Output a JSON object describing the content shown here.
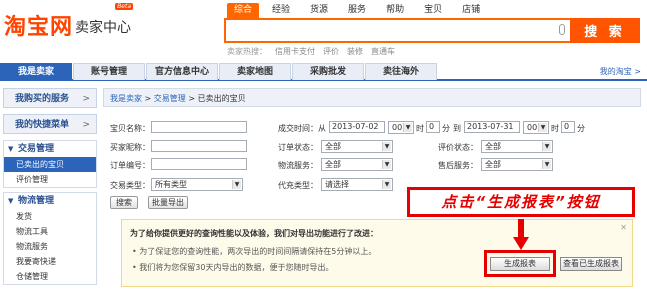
{
  "logo": {
    "main": "淘宝网",
    "sub": "卖家中心",
    "beta": "Beta"
  },
  "top_tabs": [
    "综合",
    "经验",
    "货源",
    "服务",
    "帮助",
    "宝贝",
    "店铺"
  ],
  "search": {
    "button": "搜 索",
    "value": ""
  },
  "hot": {
    "label": "卖家热搜：",
    "items": [
      "信用卡支付",
      "评价",
      "装修",
      "直通车"
    ]
  },
  "nav": {
    "items": [
      "我是卖家",
      "账号管理",
      "官方信息中心",
      "卖家地图",
      "采购批发",
      "卖往海外"
    ],
    "right": "我的淘宝 >"
  },
  "sidebar": {
    "boxes": [
      "我购买的服务",
      "我的快捷菜单"
    ],
    "arrow": ">",
    "section1": {
      "head": "交易管理",
      "links": [
        "已卖出的宝贝",
        "评价管理"
      ]
    },
    "section2": {
      "head": "物流管理",
      "links": [
        "发货",
        "物流工具",
        "物流服务",
        "我要寄快递",
        "仓储管理"
      ]
    }
  },
  "breadcrumb": {
    "a": "我是卖家",
    "sep": " > ",
    "b": "交易管理",
    "c": "已卖出的宝贝"
  },
  "form": {
    "item_name": "宝贝名称：",
    "buyer_nick": "买家昵称：",
    "order_no": "订单编号：",
    "trade_type": "交易类型：",
    "trade_type_value": "所有类型",
    "deal_time": "成交时间：从",
    "date_from": "2013-07-02",
    "hour_from": "00",
    "min_from": "0",
    "to": "到",
    "date_to": "2013-07-31",
    "hour_to": "00",
    "min_to": "0",
    "hour_unit": "时",
    "min_unit": "分",
    "order_status": "订单状态：",
    "order_status_value": "全部",
    "logistics": "物流服务：",
    "logistics_value": "全部",
    "collect_type": "代充类型：",
    "collect_type_value": "请选择",
    "rate_status": "评价状态：",
    "rate_status_value": "全部",
    "after_sale": "售后服务：",
    "after_sale_value": "全部",
    "search_btn": "搜索",
    "export_btn": "批量导出"
  },
  "notice": {
    "title": "为了给你提供更好的查询性能以及体验，我们对导出功能进行了改进：",
    "line1": "为了保证您的查询性能，两次导出的时间间隔请保持在5分钟以上。",
    "line2": "我们将为您保留30天内导出的数据，便于您随时导出。",
    "bullet": "•",
    "close": "✕",
    "gen_btn": "生成报表",
    "view_btn": "查看已生成报表"
  },
  "callout": "点击“生成报表”按钮",
  "colors": {
    "orange": "#ff5500",
    "blue": "#2b64b9",
    "red": "#e60000"
  }
}
